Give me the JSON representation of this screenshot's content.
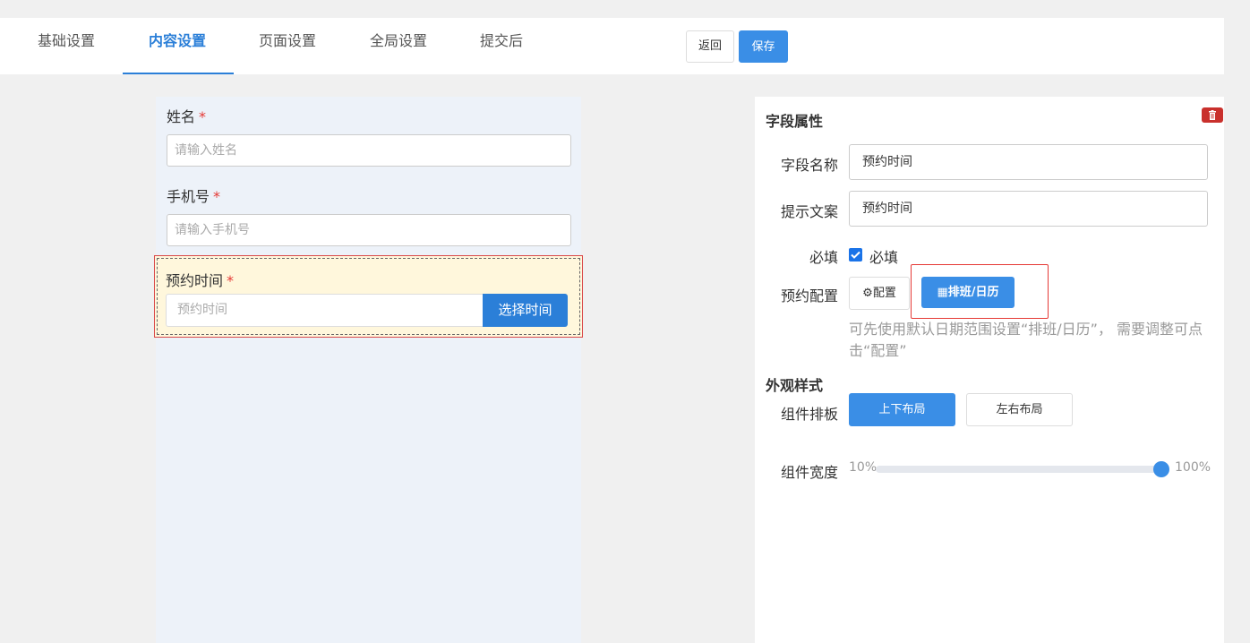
{
  "tabs": [
    {
      "label": "基础设置",
      "active": false
    },
    {
      "label": "内容设置",
      "active": true
    },
    {
      "label": "页面设置",
      "active": false
    },
    {
      "label": "全局设置",
      "active": false
    },
    {
      "label": "提交后",
      "active": false
    }
  ],
  "toolbar": {
    "back_label": "返回",
    "save_label": "保存"
  },
  "form": {
    "fields": [
      {
        "label": "姓名",
        "placeholder": "请输入姓名"
      },
      {
        "label": "手机号",
        "placeholder": "请输入手机号"
      }
    ],
    "selected_field": {
      "label": "预约时间",
      "placeholder": "预约时间",
      "button_label": "选择时间"
    },
    "required_mark": "*"
  },
  "props": {
    "title": "字段属性",
    "name_label": "字段名称",
    "name_value": "预约时间",
    "hint_label": "提示文案",
    "hint_value": "预约时间",
    "required_label": "必填",
    "required_check_label": "必填",
    "required_checked": true,
    "booking_label": "预约配置",
    "config_button": "配置",
    "calendar_button": "排班/日历",
    "booking_hint": "可先使用默认日期范围设置“排班/日历”， 需要调整可点击“配置”",
    "appearance_title": "外观样式",
    "layout_label": "组件排板",
    "layout_vertical": "上下布局",
    "layout_horizontal": "左右布局",
    "width_label": "组件宽度",
    "width_min": "10%",
    "width_max": "100%",
    "width_value_percent": 100
  },
  "colors": {
    "accent": "#3a8ee6",
    "danger": "#e53935"
  }
}
